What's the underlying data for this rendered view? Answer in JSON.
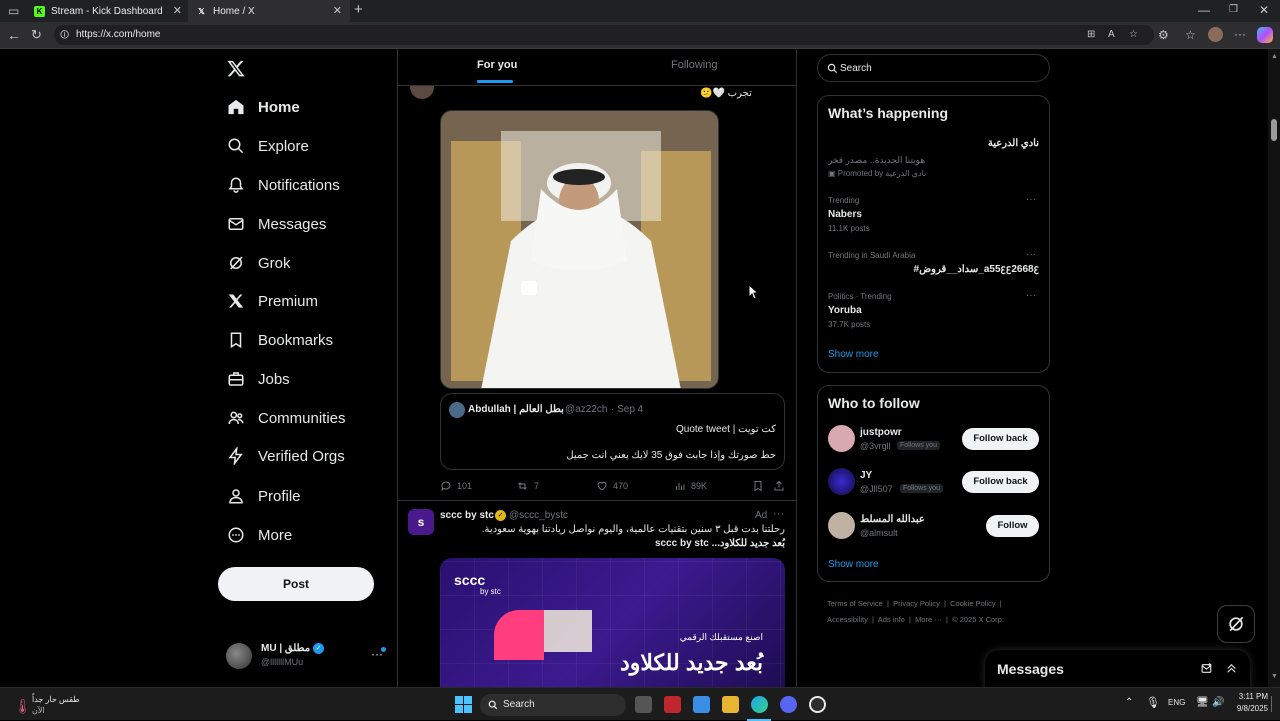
{
  "browser": {
    "tabs": [
      {
        "label": "Stream - Kick Dashboard",
        "active": false
      },
      {
        "label": "Home / X",
        "active": true
      }
    ],
    "url": "https://x.com/home"
  },
  "nav": {
    "items": [
      {
        "label": "Home",
        "icon": "home-icon"
      },
      {
        "label": "Explore",
        "icon": "search-icon"
      },
      {
        "label": "Notifications",
        "icon": "bell-icon"
      },
      {
        "label": "Messages",
        "icon": "mail-icon"
      },
      {
        "label": "Grok",
        "icon": "grok-icon"
      },
      {
        "label": "Premium",
        "icon": "x-logo-icon"
      },
      {
        "label": "Bookmarks",
        "icon": "bookmark-icon"
      },
      {
        "label": "Jobs",
        "icon": "briefcase-icon"
      },
      {
        "label": "Communities",
        "icon": "people-icon"
      },
      {
        "label": "Verified Orgs",
        "icon": "lightning-icon"
      },
      {
        "label": "Profile",
        "icon": "person-icon"
      },
      {
        "label": "More",
        "icon": "more-circle-icon"
      }
    ],
    "post_label": "Post",
    "account": {
      "name": "MU | مطلق",
      "handle": "@lllllllMUu"
    }
  },
  "feed": {
    "tabs": [
      {
        "label": "For you",
        "active": true
      },
      {
        "label": "Following",
        "active": false
      }
    ],
    "tweet1": {
      "text": "تجرب 🤍😕",
      "quote": {
        "author": "Abdullah | بطل العالم",
        "handle": "@az22ch",
        "date": "· Sep 4",
        "line1": "كت تويت | Quote tweet",
        "line2": "حط صورتك وإذا جابت فوق 35 لايك يعني انت جميل"
      },
      "stats": {
        "replies": "101",
        "reposts": "7",
        "likes": "470",
        "views": "89K"
      }
    },
    "tweet2": {
      "author": "sccc by stc",
      "handle": "@sccc_bystc",
      "ad_label": "Ad",
      "text1": "رحلتنا بدت قبل ٣ سنين بتقنيات عالمية، واليوم نواصل ريادتنا بهوية سعودية.",
      "text2": "بُعد جديد للكلاود... sccc by stc",
      "image": {
        "brand": "sccc",
        "by": "by stc",
        "line1": "اصنع مستقبلك الرقمي",
        "line2": "بُعد جديد للكلاود"
      }
    }
  },
  "sidebar": {
    "search_placeholder": "Search",
    "happening": {
      "title": "What’s happening",
      "promo": {
        "title": "نادي الدرعية",
        "subtitle": "هويتنا الجديدة.. مصدر فخر",
        "promoted": "Promoted by نادي الدرعية"
      },
      "trends": [
        {
          "context": "Trending",
          "name": "Nabers",
          "posts": "11.1K posts"
        },
        {
          "context": "Trending in Saudi Arabia",
          "name": "#سداد__قروض_a55ꜫꜫ2668ꜫ",
          "posts": ""
        },
        {
          "context": "Politics · Trending",
          "name": "Yoruba",
          "posts": "37.7K posts"
        }
      ],
      "show_more": "Show more"
    },
    "who_to_follow": {
      "title": "Who to follow",
      "users": [
        {
          "name": "justpowr",
          "handle": "@3vrgll",
          "badge": "Follows you",
          "button": "Follow back"
        },
        {
          "name": "JY",
          "handle": "@Jll507",
          "badge": "Follows you",
          "button": "Follow back"
        },
        {
          "name": "عبدالله المسلط",
          "handle": "@almsult",
          "badge": "",
          "button": "Follow"
        }
      ],
      "show_more": "Show more"
    },
    "footer": {
      "line1": [
        "Terms of Service",
        "Privacy Policy",
        "Cookie Policy"
      ],
      "line2": [
        "Accessibility",
        "Ads info",
        "More ···",
        "© 2025 X Corp."
      ]
    },
    "messages_drawer": "Messages"
  },
  "taskbar": {
    "weather": {
      "line1": "طقس حار جداً",
      "line2": "الآن"
    },
    "search": "Search",
    "lang": "ENG",
    "time": "3:11 PM",
    "date": "9/8/2025"
  }
}
